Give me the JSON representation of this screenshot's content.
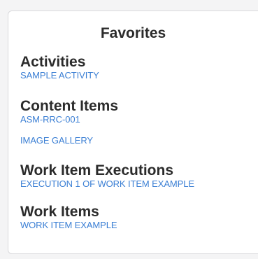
{
  "favorites": {
    "title": "Favorites",
    "groups": [
      {
        "heading": "Activities",
        "links": [
          "SAMPLE ACTIVITY"
        ]
      },
      {
        "heading": "Content Items",
        "links": [
          "ASM-RRC-001",
          "IMAGE GALLERY"
        ]
      },
      {
        "heading": "Work Item Executions",
        "links": [
          "EXECUTION 1 OF WORK ITEM EXAMPLE"
        ]
      },
      {
        "heading": "Work Items",
        "links": [
          "WORK ITEM EXAMPLE"
        ]
      }
    ]
  },
  "colors": {
    "link": "#3b7fd4",
    "heading": "#2b2b2b",
    "card_border": "#d9d9dc",
    "page_background": "#f4f4f5"
  }
}
